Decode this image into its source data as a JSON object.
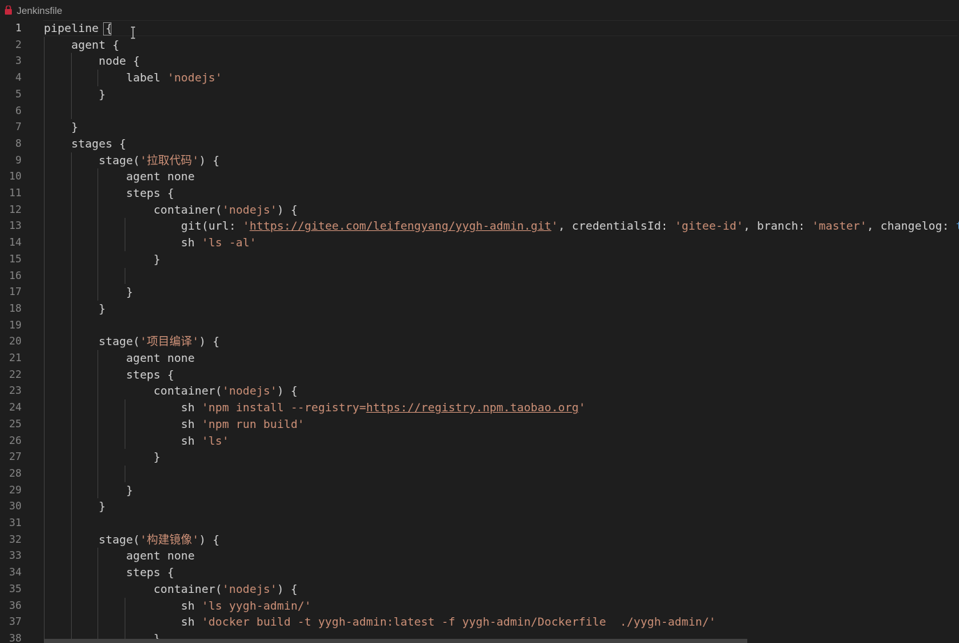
{
  "breadcrumb": {
    "filename": "Jenkinsfile",
    "icon": "jenkins-file-icon"
  },
  "colors": {
    "background": "#1e1e1e",
    "string": "#ce9178",
    "keyword": "#569cd6",
    "text": "#d4d4d4",
    "line_number": "#858585"
  },
  "editor": {
    "active_line": 1,
    "lines": [
      {
        "n": "1",
        "tokens": [
          [
            "p",
            "pipeline "
          ],
          [
            "p",
            "{"
          ]
        ]
      },
      {
        "n": "2",
        "tokens": [
          [
            "p",
            "    agent {"
          ]
        ]
      },
      {
        "n": "3",
        "tokens": [
          [
            "p",
            "        node {"
          ]
        ]
      },
      {
        "n": "4",
        "tokens": [
          [
            "p",
            "            label "
          ],
          [
            "s",
            "'nodejs'"
          ]
        ]
      },
      {
        "n": "5",
        "tokens": [
          [
            "p",
            "        }"
          ]
        ]
      },
      {
        "n": "6",
        "tokens": []
      },
      {
        "n": "7",
        "tokens": [
          [
            "p",
            "    }"
          ]
        ]
      },
      {
        "n": "8",
        "tokens": [
          [
            "p",
            "    stages {"
          ]
        ]
      },
      {
        "n": "9",
        "tokens": [
          [
            "p",
            "        stage("
          ],
          [
            "s",
            "'拉取代码'"
          ],
          [
            "p",
            ") {"
          ]
        ]
      },
      {
        "n": "10",
        "tokens": [
          [
            "p",
            "            agent none"
          ]
        ]
      },
      {
        "n": "11",
        "tokens": [
          [
            "p",
            "            steps {"
          ]
        ]
      },
      {
        "n": "12",
        "tokens": [
          [
            "p",
            "                container("
          ],
          [
            "s",
            "'nodejs'"
          ],
          [
            "p",
            ") {"
          ]
        ]
      },
      {
        "n": "13",
        "tokens": [
          [
            "p",
            "                    git(url: "
          ],
          [
            "s",
            "'"
          ],
          [
            "u",
            "https://gitee.com/leifengyang/yygh-admin.git"
          ],
          [
            "s",
            "'"
          ],
          [
            "p",
            ", credentialsId: "
          ],
          [
            "s",
            "'gitee-id'"
          ],
          [
            "p",
            ", branch: "
          ],
          [
            "s",
            "'master'"
          ],
          [
            "p",
            ", changelog: "
          ],
          [
            "k",
            "true"
          ]
        ]
      },
      {
        "n": "14",
        "tokens": [
          [
            "p",
            "                    sh "
          ],
          [
            "s",
            "'ls -al'"
          ]
        ]
      },
      {
        "n": "15",
        "tokens": [
          [
            "p",
            "                }"
          ]
        ]
      },
      {
        "n": "16",
        "tokens": []
      },
      {
        "n": "17",
        "tokens": [
          [
            "p",
            "            }"
          ]
        ]
      },
      {
        "n": "18",
        "tokens": [
          [
            "p",
            "        }"
          ]
        ]
      },
      {
        "n": "19",
        "tokens": []
      },
      {
        "n": "20",
        "tokens": [
          [
            "p",
            "        stage("
          ],
          [
            "s",
            "'项目编译'"
          ],
          [
            "p",
            ") {"
          ]
        ]
      },
      {
        "n": "21",
        "tokens": [
          [
            "p",
            "            agent none"
          ]
        ]
      },
      {
        "n": "22",
        "tokens": [
          [
            "p",
            "            steps {"
          ]
        ]
      },
      {
        "n": "23",
        "tokens": [
          [
            "p",
            "                container("
          ],
          [
            "s",
            "'nodejs'"
          ],
          [
            "p",
            ") {"
          ]
        ]
      },
      {
        "n": "24",
        "tokens": [
          [
            "p",
            "                    sh "
          ],
          [
            "s",
            "'npm install --registry="
          ],
          [
            "u",
            "https://registry.npm.taobao.org"
          ],
          [
            "s",
            "'"
          ]
        ]
      },
      {
        "n": "25",
        "tokens": [
          [
            "p",
            "                    sh "
          ],
          [
            "s",
            "'npm run build'"
          ]
        ]
      },
      {
        "n": "26",
        "tokens": [
          [
            "p",
            "                    sh "
          ],
          [
            "s",
            "'ls'"
          ]
        ]
      },
      {
        "n": "27",
        "tokens": [
          [
            "p",
            "                }"
          ]
        ]
      },
      {
        "n": "28",
        "tokens": []
      },
      {
        "n": "29",
        "tokens": [
          [
            "p",
            "            }"
          ]
        ]
      },
      {
        "n": "30",
        "tokens": [
          [
            "p",
            "        }"
          ]
        ]
      },
      {
        "n": "31",
        "tokens": []
      },
      {
        "n": "32",
        "tokens": [
          [
            "p",
            "        stage("
          ],
          [
            "s",
            "'构建镜像'"
          ],
          [
            "p",
            ") {"
          ]
        ]
      },
      {
        "n": "33",
        "tokens": [
          [
            "p",
            "            agent none"
          ]
        ]
      },
      {
        "n": "34",
        "tokens": [
          [
            "p",
            "            steps {"
          ]
        ]
      },
      {
        "n": "35",
        "tokens": [
          [
            "p",
            "                container("
          ],
          [
            "s",
            "'nodejs'"
          ],
          [
            "p",
            ") {"
          ]
        ]
      },
      {
        "n": "36",
        "tokens": [
          [
            "p",
            "                    sh "
          ],
          [
            "s",
            "'ls yygh-admin/'"
          ]
        ]
      },
      {
        "n": "37",
        "tokens": [
          [
            "p",
            "                    sh "
          ],
          [
            "s",
            "'docker build -t yygh-admin:latest -f yygh-admin/Dockerfile  ./yygh-admin/'"
          ]
        ]
      },
      {
        "n": "38",
        "tokens": [
          [
            "p",
            "                }"
          ]
        ]
      }
    ]
  }
}
